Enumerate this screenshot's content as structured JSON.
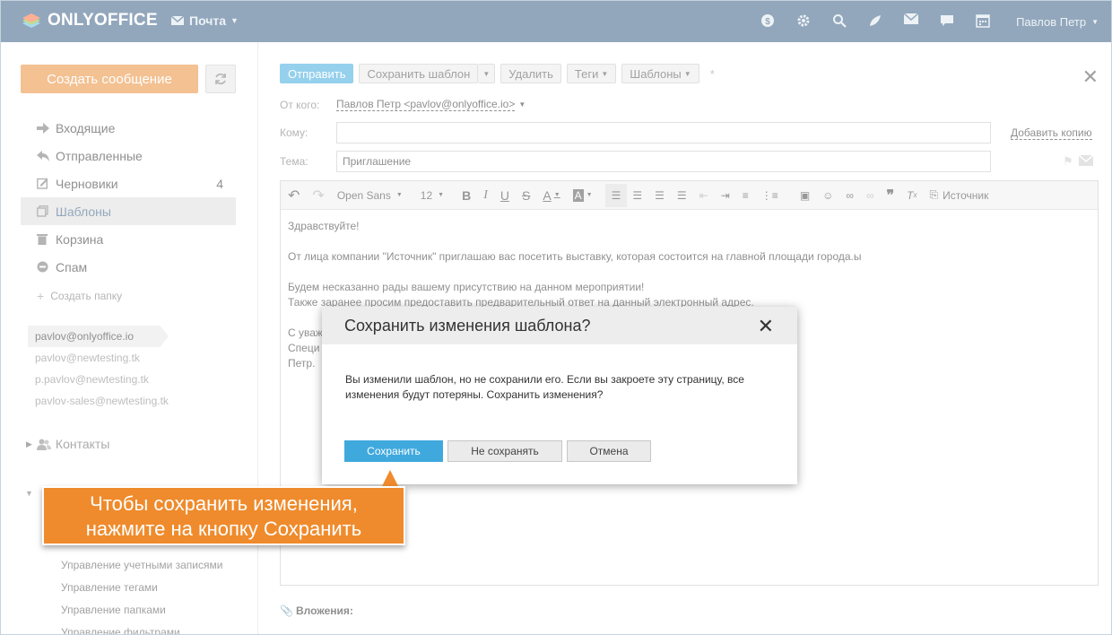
{
  "topbar": {
    "logo_text": "ONLYOFFICE",
    "module": "Почта",
    "user": "Павлов Петр",
    "icons": [
      "dollar-icon",
      "gear-icon",
      "search-icon",
      "feed-icon",
      "mail-icon",
      "chat-icon",
      "calendar-icon"
    ],
    "bg_color": "#3a5f85"
  },
  "sidebar": {
    "create_button": "Создать сообщение",
    "nav": [
      {
        "label": "Входящие",
        "icon": "inbox-icon",
        "count": ""
      },
      {
        "label": "Отправленные",
        "icon": "sent-icon",
        "count": ""
      },
      {
        "label": "Черновики",
        "icon": "draft-icon",
        "count": "4"
      },
      {
        "label": "Шаблоны",
        "icon": "template-icon",
        "count": "",
        "active": true
      },
      {
        "label": "Корзина",
        "icon": "trash-icon",
        "count": ""
      },
      {
        "label": "Спам",
        "icon": "spam-icon",
        "count": ""
      }
    ],
    "create_folder": "Создать папку",
    "accounts": [
      "pavlov@onlyoffice.io",
      "pavlov@newtesting.tk",
      "p.pavlov@newtesting.tk",
      "pavlov-sales@newtesting.tk"
    ],
    "contacts": "Контакты",
    "settings": [
      "Управление учетными записями",
      "Управление тегами",
      "Управление папками",
      "Управление фильтрами"
    ]
  },
  "compose": {
    "toolbar": {
      "send": "Отправить",
      "save_template": "Сохранить шаблон",
      "delete": "Удалить",
      "tags": "Теги",
      "templates": "Шаблоны",
      "modified_mark": "*"
    },
    "from_label": "От кого:",
    "from_value": "Павлов Петр <pavlov@onlyoffice.io>",
    "to_label": "Кому:",
    "to_value": "",
    "add_copy": "Добавить копию",
    "subject_label": "Тема:",
    "subject_value": "Приглашение",
    "editor": {
      "font": "Open Sans",
      "size": "12",
      "source": "Источник"
    },
    "body": {
      "line1": "Здравствуйте!",
      "line2": "От лица компании \"Источник\" приглашаю вас посетить выставку, которая состоится на главной площади города.ы",
      "line3": "Будем несказанно рады вашему присутствию на данном мероприятии!",
      "line4": "Также заранее просим предоставить предварительный ответ на данный электронный адрес.",
      "line5": "С уваж",
      "line6": "Специ",
      "line7": "Петр."
    },
    "attachments": "Вложения:"
  },
  "modal": {
    "title": "Сохранить изменения шаблона?",
    "text": "Вы изменили шаблон, но не сохранили его. Если вы закроете эту страницу, все изменения будут потеряны. Сохранить изменения?",
    "save": "Сохранить",
    "dont_save": "Не сохранять",
    "cancel": "Отмена"
  },
  "callout": {
    "line1": "Чтобы сохранить изменения,",
    "line2": "нажмите на кнопку Сохранить",
    "color": "#ef8b2c"
  }
}
